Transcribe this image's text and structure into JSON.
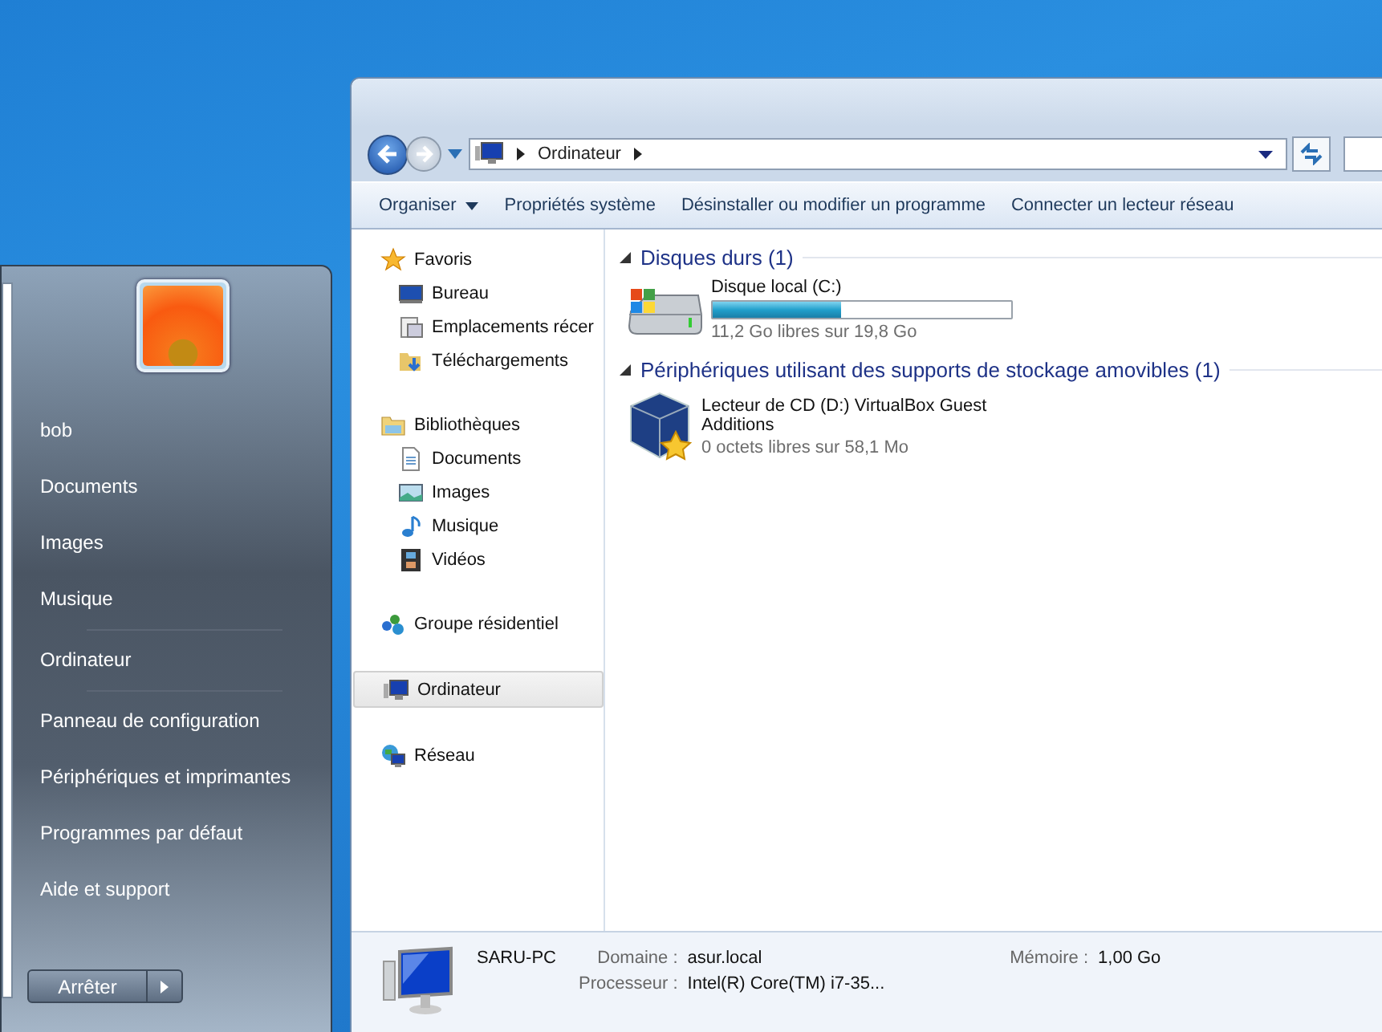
{
  "explorer": {
    "address": {
      "crumbs": [
        "Ordinateur"
      ]
    },
    "toolbar": [
      {
        "label": "Organiser",
        "dropdown": true
      },
      {
        "label": "Propriétés système",
        "dropdown": false
      },
      {
        "label": "Désinstaller ou modifier un programme",
        "dropdown": false
      },
      {
        "label": "Connecter un lecteur réseau",
        "dropdown": false
      }
    ],
    "sidebar": [
      {
        "label": "Favoris",
        "selected": false,
        "children": [
          {
            "label": "Bureau",
            "selected": false
          },
          {
            "label": "Emplacements récer",
            "selected": false
          },
          {
            "label": "Téléchargements",
            "selected": false
          }
        ]
      },
      {
        "label": "Bibliothèques",
        "selected": false,
        "children": [
          {
            "label": "Documents",
            "selected": false
          },
          {
            "label": "Images",
            "selected": false
          },
          {
            "label": "Musique",
            "selected": false
          },
          {
            "label": "Vidéos",
            "selected": false
          }
        ]
      },
      {
        "label": "Groupe résidentiel",
        "selected": false
      },
      {
        "label": "Ordinateur",
        "selected": true
      },
      {
        "label": "Réseau",
        "selected": false
      }
    ],
    "groups": [
      {
        "title": "Disques durs (1)",
        "expanded": true,
        "items": [
          {
            "kind": "hdd",
            "name": "Disque local (C:)",
            "level": 0.43,
            "detail": "11,2 Go libres sur 19,8 Go"
          }
        ]
      },
      {
        "title": "Périphériques utilisant des supports de stockage amovibles (1)",
        "expanded": true,
        "items": [
          {
            "kind": "cd",
            "name": "Lecteur de CD (D:) VirtualBox Guest Additions",
            "detail": "0 octets libres sur 58,1 Mo"
          }
        ]
      }
    ],
    "details": {
      "name": "SARU-PC",
      "fields": [
        {
          "label": "Domaine :",
          "value": "asur.local"
        },
        {
          "label": "Mémoire :",
          "value": "1,00 Go"
        },
        {
          "label": "Processeur :",
          "value": "Intel(R) Core(TM) i7-35..."
        }
      ]
    }
  },
  "start_menu": {
    "groups": [
      {
        "items": [
          "bob",
          "Documents",
          "Images",
          "Musique"
        ]
      },
      {
        "items": [
          "Ordinateur"
        ]
      },
      {
        "items": [
          "Panneau de configuration",
          "Périphériques et imprimantes",
          "Programmes par défaut",
          "Aide et support"
        ]
      }
    ],
    "shutdown": "Arrêter"
  }
}
